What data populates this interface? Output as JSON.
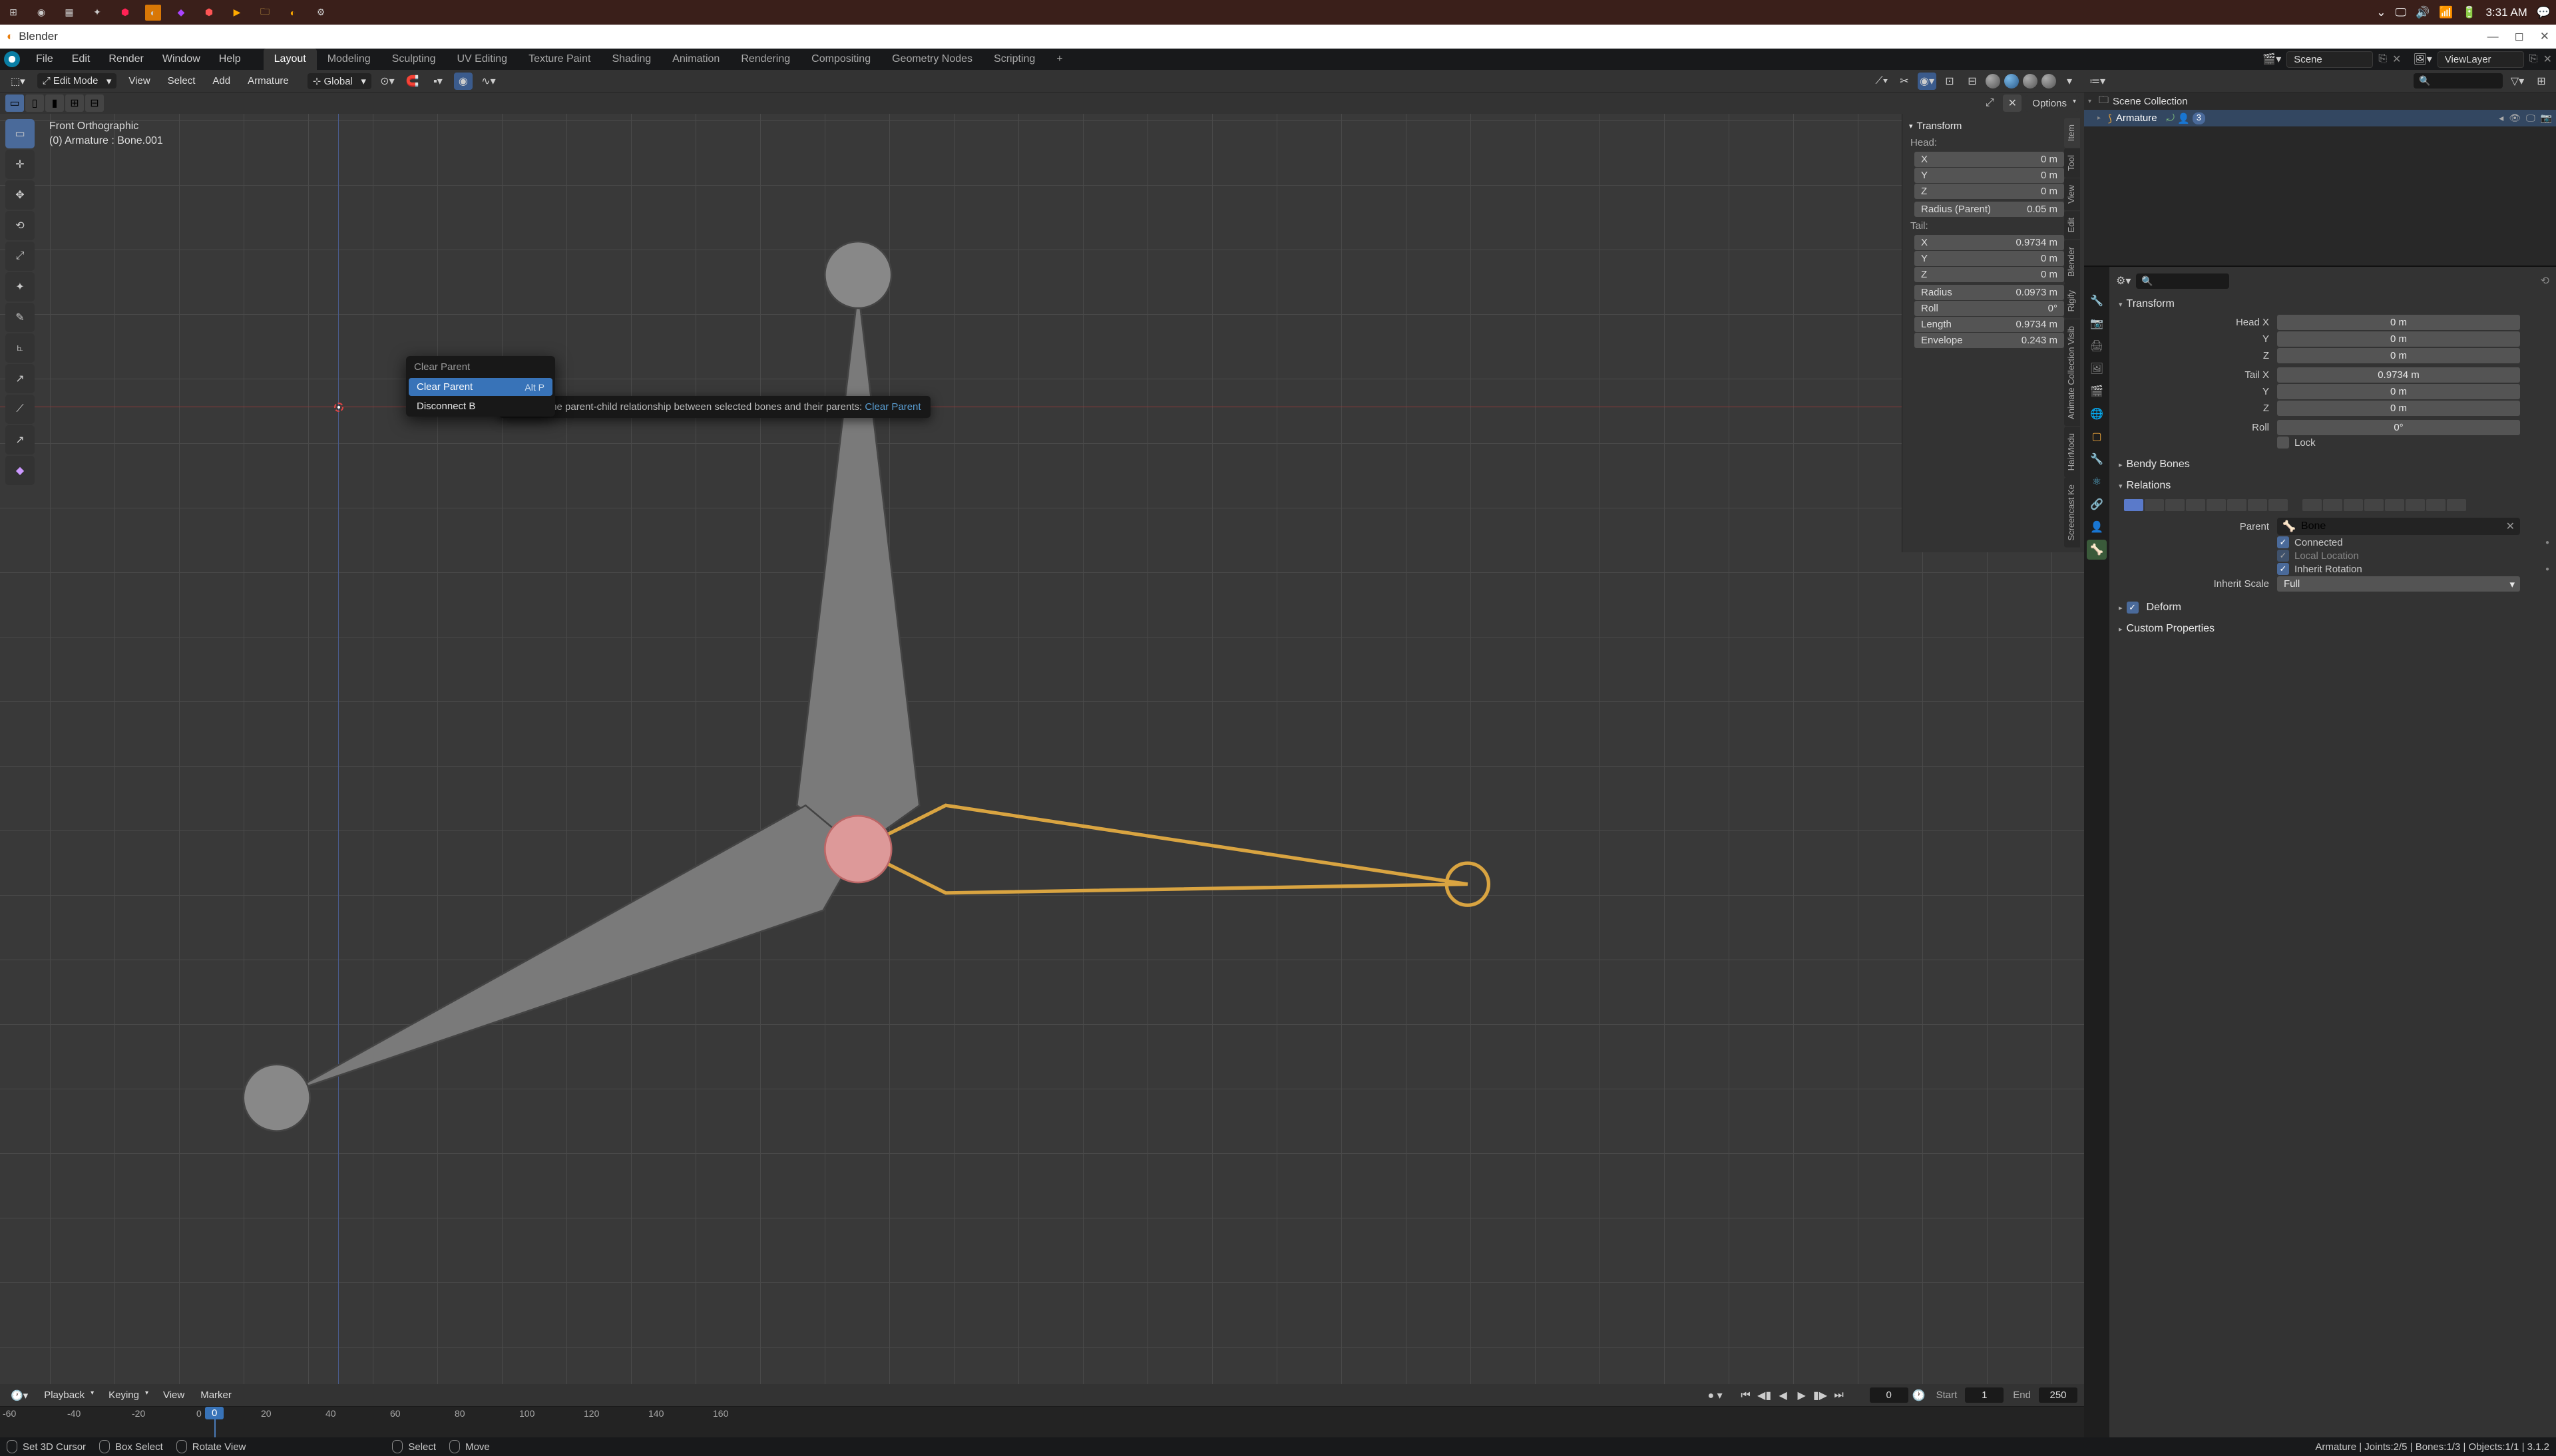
{
  "os_taskbar": {
    "time": "3:31 AM"
  },
  "window": {
    "title": "Blender"
  },
  "main_menu": {
    "items": [
      "File",
      "Edit",
      "Render",
      "Window",
      "Help"
    ]
  },
  "workspace_tabs": [
    "Layout",
    "Modeling",
    "Sculpting",
    "UV Editing",
    "Texture Paint",
    "Shading",
    "Animation",
    "Rendering",
    "Compositing",
    "Geometry Nodes",
    "Scripting"
  ],
  "active_workspace": "Layout",
  "scene": {
    "name": "Scene",
    "layer": "ViewLayer"
  },
  "viewport": {
    "mode": "Edit Mode",
    "header_items": [
      "View",
      "Select",
      "Add",
      "Armature"
    ],
    "orientation": "Global",
    "options_label": "Options",
    "info_line1": "Front Orthographic",
    "info_line2": "(0) Armature : Bone.001"
  },
  "context_menu": {
    "title": "Clear Parent",
    "items": [
      {
        "label": "Clear Parent",
        "shortcut": "Alt P"
      },
      {
        "label": "Disconnect B",
        "shortcut": ""
      }
    ]
  },
  "tooltip": {
    "text": "Remove the parent-child relationship between selected bones and their parents:",
    "command": "Clear Parent"
  },
  "npanel": {
    "title": "Transform",
    "head_label": "Head:",
    "tail_label": "Tail:",
    "head": {
      "X": "0 m",
      "Y": "0 m",
      "Z": "0 m"
    },
    "radius_parent": {
      "label": "Radius (Parent)",
      "value": "0.05 m"
    },
    "tail": {
      "X": "0.9734 m",
      "Y": "0 m",
      "Z": "0 m"
    },
    "radius": {
      "label": "Radius",
      "value": "0.0973 m"
    },
    "roll": {
      "label": "Roll",
      "value": "0°"
    },
    "length": {
      "label": "Length",
      "value": "0.9734 m"
    },
    "envelope": {
      "label": "Envelope",
      "value": "0.243 m"
    },
    "tabs": [
      "Item",
      "Tool",
      "View",
      "Edit",
      "Blender",
      "Rigify",
      "Animate Collection Visib",
      "HairModu",
      "Screencast Ke"
    ]
  },
  "outliner": {
    "scene_collection": "Scene Collection",
    "armature": "Armature",
    "bone_count": "3"
  },
  "properties": {
    "transform": {
      "title": "Transform",
      "head_x": {
        "label": "Head X",
        "value": "0 m"
      },
      "head_y": {
        "label": "Y",
        "value": "0 m"
      },
      "head_z": {
        "label": "Z",
        "value": "0 m"
      },
      "tail_x": {
        "label": "Tail X",
        "value": "0.9734 m"
      },
      "tail_y": {
        "label": "Y",
        "value": "0 m"
      },
      "tail_z": {
        "label": "Z",
        "value": "0 m"
      },
      "roll": {
        "label": "Roll",
        "value": "0°"
      },
      "lock": "Lock"
    },
    "bendy": "Bendy Bones",
    "relations": {
      "title": "Relations",
      "parent_label": "Parent",
      "parent_value": "Bone",
      "connected": "Connected",
      "local_location": "Local Location",
      "inherit_rotation": "Inherit Rotation",
      "inherit_scale_label": "Inherit Scale",
      "inherit_scale_value": "Full"
    },
    "deform": "Deform",
    "custom_props": "Custom Properties"
  },
  "timeline": {
    "menus": [
      "Playback",
      "Keying",
      "View",
      "Marker"
    ],
    "current": "0",
    "start_label": "Start",
    "start": "1",
    "end_label": "End",
    "end": "250",
    "ticks": [
      "-60",
      "-40",
      "-20",
      "0",
      "20",
      "40",
      "60",
      "80",
      "100",
      "120",
      "140",
      "160"
    ]
  },
  "status_bar": {
    "items": [
      "Set 3D Cursor",
      "Box Select",
      "Rotate View",
      "Select",
      "Move"
    ],
    "right": "Armature | Joints:2/5 | Bones:1/3 | Objects:1/1 | 3.1.2"
  }
}
